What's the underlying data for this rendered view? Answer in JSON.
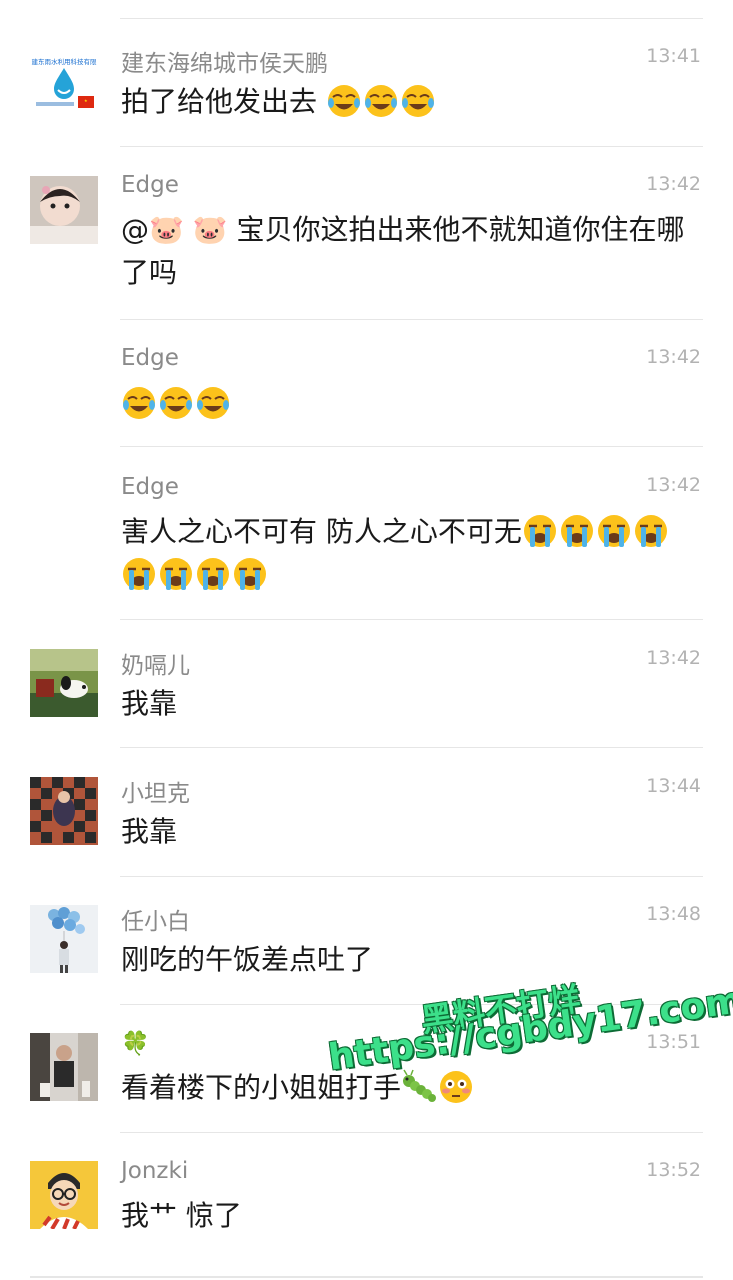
{
  "messages": [
    {
      "sender": "建东海绵城市侯天鹏",
      "time": "13:41",
      "text": "拍了给他发出去",
      "emojis": [
        "laughing-crying",
        "laughing-crying",
        "laughing-crying"
      ],
      "avatar": "logo"
    },
    {
      "sender": "Edge",
      "time": "13:42",
      "text": "@🐷 🐷 宝贝你这拍出来他不就知道你住在哪了吗",
      "emojis": [],
      "avatar": "girl"
    },
    {
      "sender": "Edge",
      "time": "13:42",
      "text": "",
      "emojis": [
        "laughing-crying",
        "laughing-crying",
        "laughing-crying"
      ],
      "avatar": ""
    },
    {
      "sender": "Edge",
      "time": "13:42",
      "text": "害人之心不可有 防人之心不可无",
      "emojis": [
        "loudly-crying",
        "loudly-crying",
        "loudly-crying",
        "loudly-crying",
        "loudly-crying",
        "loudly-crying",
        "loudly-crying",
        "loudly-crying"
      ],
      "avatar": ""
    },
    {
      "sender": "奶嗝儿",
      "time": "13:42",
      "text": "我靠",
      "emojis": [],
      "avatar": "snoopy"
    },
    {
      "sender": "小坦克",
      "time": "13:44",
      "text": "我靠",
      "emojis": [],
      "avatar": "checker"
    },
    {
      "sender": "任小白",
      "time": "13:48",
      "text": "刚吃的午饭差点吐了",
      "emojis": [],
      "avatar": "balloons"
    },
    {
      "sender": "🍀",
      "time": "13:51",
      "text": "看着楼下的小姐姐打手",
      "emojis": [
        "caterpillar",
        "flushed"
      ],
      "avatar": "photo"
    },
    {
      "sender": "Jonzki",
      "time": "13:52",
      "text": "我艹 惊了",
      "emojis": [],
      "avatar": "cartoon"
    }
  ],
  "avatar_logo_text": "建东雨水利用科技有限",
  "watermark": {
    "line1": "黑料不打烊",
    "line2": "https://cgbdy17.com"
  },
  "colors": {
    "sender": "#8a8a8a",
    "time": "#b2b2b2",
    "text": "#1a1a1a",
    "watermark": "#3ce08a"
  }
}
